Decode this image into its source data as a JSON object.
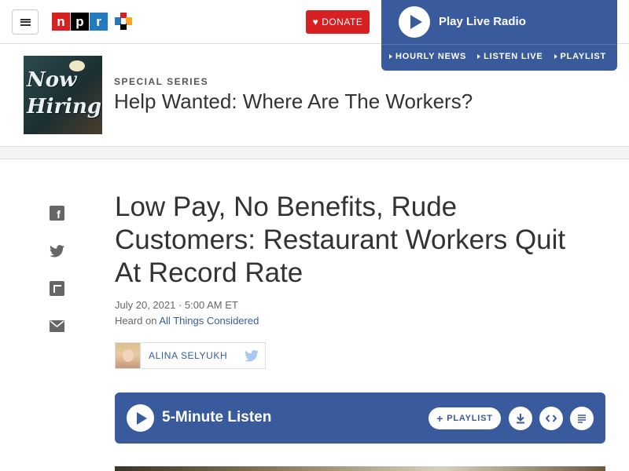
{
  "header": {
    "menu_icon": "hamburger-icon",
    "logo_letters": [
      "n",
      "p",
      "r"
    ],
    "donate_label": "DONATE",
    "brand_colors": {
      "red": "#d62021",
      "black": "#000000",
      "blue": "#237bbd"
    }
  },
  "radio": {
    "title": "Play Live Radio",
    "links": [
      "HOURLY NEWS",
      "LISTEN LIVE",
      "PLAYLIST"
    ],
    "accent": "#3a5a9e"
  },
  "series": {
    "kicker": "SPECIAL SERIES",
    "title": "Help Wanted: Where Are The Workers?",
    "image_text": "Now Hiring"
  },
  "share": {
    "icons": [
      "facebook-icon",
      "twitter-icon",
      "flipboard-icon",
      "email-icon"
    ]
  },
  "article": {
    "headline": "Low Pay, No Benefits, Rude Customers: Restaurant Workers Quit At Record Rate",
    "dateline": "July 20, 2021 · 5:00 AM ET",
    "heard_prefix": "Heard on ",
    "heard_show": "All Things Considered",
    "author": "ALINA SELYUKH"
  },
  "listen": {
    "title": "5-Minute Listen",
    "playlist_label": "PLAYLIST"
  }
}
